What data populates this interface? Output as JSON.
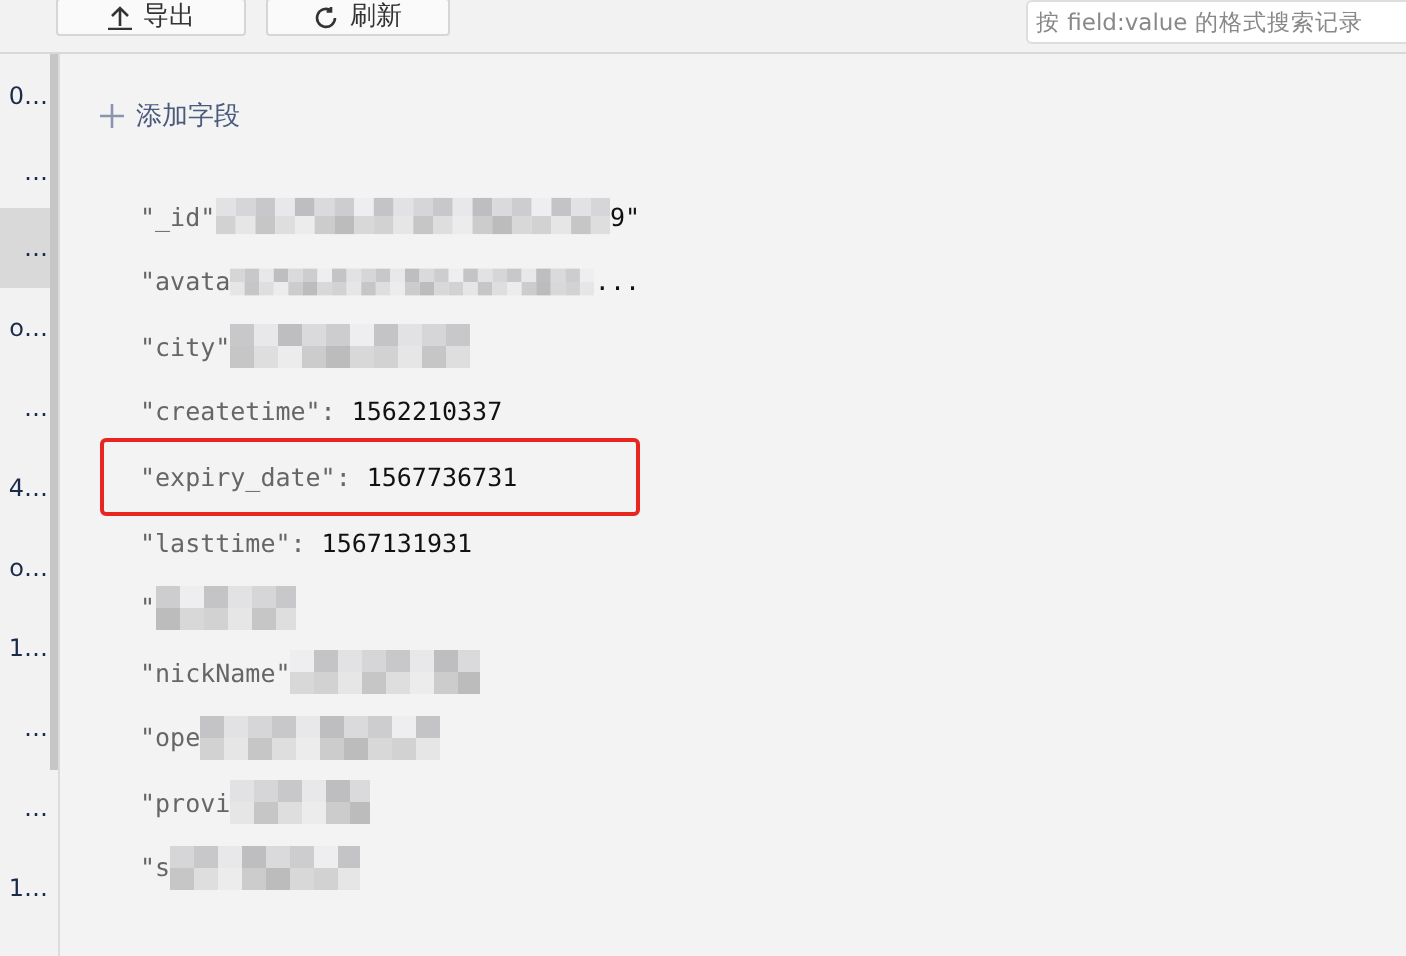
{
  "toolbar": {
    "buttons": [
      {
        "kind": "export",
        "label": "导出"
      },
      {
        "kind": "refresh",
        "label": "刷新"
      }
    ],
    "search": {
      "placeholder": "按 field:value 的格式搜索记录"
    }
  },
  "record_list": [
    {
      "text": "0…",
      "selected": false
    },
    {
      "text": "…",
      "selected": false
    },
    {
      "text": "…",
      "selected": true
    },
    {
      "text": "o…",
      "selected": false
    },
    {
      "text": "…",
      "selected": false
    },
    {
      "text": "4…",
      "selected": false
    },
    {
      "text": "o…",
      "selected": false
    },
    {
      "text": "1…",
      "selected": false
    },
    {
      "text": "…",
      "selected": false
    },
    {
      "text": "…",
      "selected": false
    },
    {
      "text": "1…",
      "selected": false
    }
  ],
  "add_field": "添加字段",
  "fields": [
    {
      "key": "\"_id\"",
      "redacted": true,
      "tail": "9\"",
      "highlighted": false
    },
    {
      "key": "\"avata",
      "redacted": true,
      "tail": "...",
      "highlighted": false
    },
    {
      "key": "\"city\"",
      "redacted": true,
      "highlighted": false
    },
    {
      "key": "\"createtime\":",
      "value": "1562210337",
      "redacted": false,
      "highlighted": false
    },
    {
      "key": "\"expiry_date\":",
      "value": "1567736731",
      "redacted": false,
      "highlighted": true
    },
    {
      "key": "\"lasttime\":",
      "value": "1567131931",
      "redacted": false,
      "highlighted": false
    },
    {
      "key": "\"",
      "redacted": true,
      "highlighted": false
    },
    {
      "key": "\"nickName\"",
      "redacted": true,
      "highlighted": false
    },
    {
      "key": "\"ope",
      "redacted": true,
      "highlighted": false
    },
    {
      "key": "\"provi",
      "redacted": true,
      "highlighted": false
    },
    {
      "key": "\"s",
      "redacted": true,
      "highlighted": false
    }
  ]
}
